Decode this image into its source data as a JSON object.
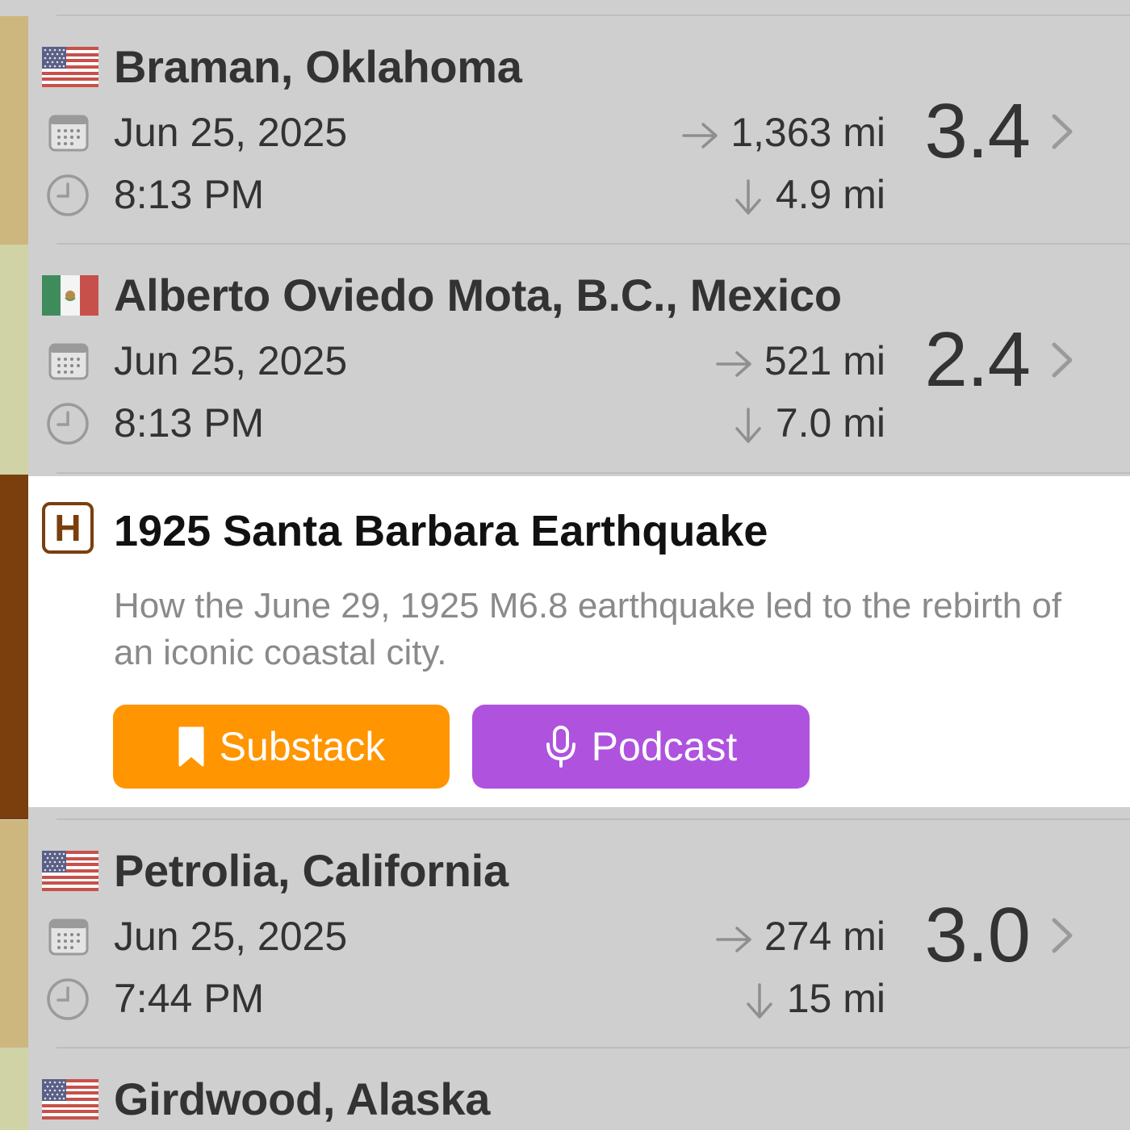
{
  "quakes": [
    {
      "place": "Braman, Oklahoma",
      "country_flag": "us-flag-icon",
      "date": "Jun 25, 2025",
      "time": "8:13 PM",
      "distance": "1,363 mi",
      "depth": "4.9 mi",
      "magnitude": "3.4",
      "strip_color": "#cdb77f"
    },
    {
      "place": "Alberto Oviedo Mota, B.C., Mexico",
      "country_flag": "mexico-flag-icon",
      "date": "Jun 25, 2025",
      "time": "8:13 PM",
      "distance": "521 mi",
      "depth": "7.0 mi",
      "magnitude": "2.4",
      "strip_color": "#cfd3a6"
    },
    {
      "place": "Petrolia, California",
      "country_flag": "us-flag-icon",
      "date": "Jun 25, 2025",
      "time": "7:44 PM",
      "distance": "274 mi",
      "depth": "15 mi",
      "magnitude": "3.0",
      "strip_color": "#cdb77f"
    },
    {
      "place": "Girdwood, Alaska",
      "country_flag": "us-flag-icon",
      "strip_color": "#cfd3a6"
    }
  ],
  "history": {
    "badge": "H",
    "title": "1925 Santa Barbara Earthquake",
    "description": "How the June 29, 1925 M6.8 earthquake led to the rebirth of an iconic coastal city.",
    "substack_label": "Substack",
    "podcast_label": "Podcast",
    "accent_color": "#7a3f0c",
    "substack_color": "#ff9500",
    "podcast_color": "#af52de"
  }
}
